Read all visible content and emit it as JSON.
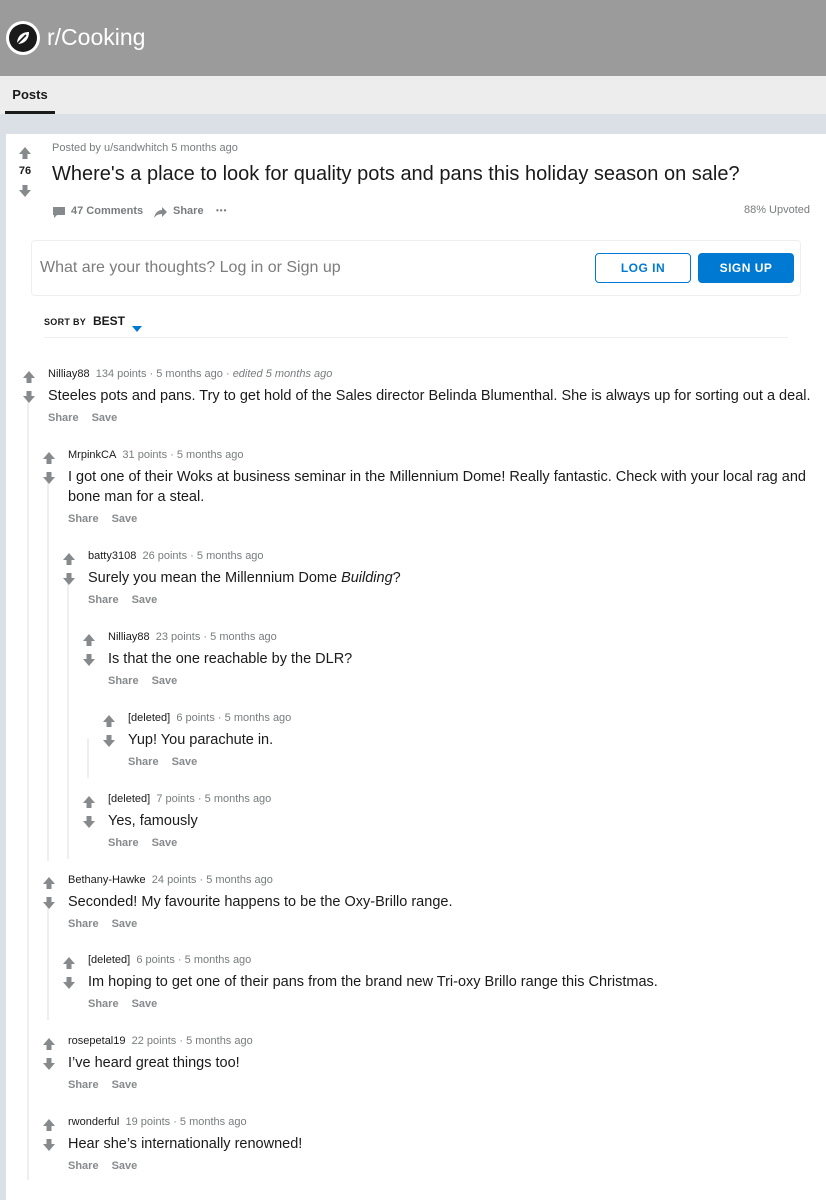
{
  "header": {
    "subreddit": "r/Cooking",
    "icon": "subreddit-leaf-icon"
  },
  "tabs": [
    {
      "label": "Posts",
      "active": true
    }
  ],
  "post": {
    "score": "76",
    "meta": "Posted by u/sandwhitch 5 months ago",
    "title": "Where's a place to look for quality pots and pans this holiday season on sale?",
    "comments_label": "47 Comments",
    "share_label": "Share",
    "more_label": "•••",
    "upvoted": "88% Upvoted"
  },
  "comment_box": {
    "placeholder": "What are your thoughts? Log in or Sign up",
    "login_label": "LOG IN",
    "signup_label": "SIGN UP"
  },
  "sort": {
    "label": "SORT BY",
    "value": "BEST"
  },
  "colors": {
    "accent": "#0079d3",
    "header_bg": "#9b9b9b",
    "page_bg": "#dae0e6",
    "arrow": "#878a8c"
  },
  "comments": [
    {
      "author": "Nilliay88",
      "points": "134 points",
      "time": "5 months ago",
      "edited": "edited 5 months ago",
      "body": "Steeles pots and pans. Try to get hold of the Sales director Belinda Blumenthal. She is always up for sorting out a deal.",
      "share": "Share",
      "save": "Save"
    },
    {
      "author": "MrpinkCA",
      "points": "31 points",
      "time": "5 months ago",
      "body_line1": "I got one of their Woks at business seminar in the Millennium Dome! Really fantastic. Check with your local rag and",
      "body_line2": "bone man for a steal.",
      "share": "Share",
      "save": "Save"
    },
    {
      "author": "batty3108",
      "points": "26 points",
      "time": "5 months ago",
      "body_pre": "Surely you mean the Millennium Dome ",
      "body_em": "Building",
      "body_post": "?",
      "share": "Share",
      "save": "Save"
    },
    {
      "author": "Nilliay88",
      "points": "23 points",
      "time": "5 months ago",
      "body": "Is that the one reachable by the DLR?",
      "share": "Share",
      "save": "Save"
    },
    {
      "author": "[deleted]",
      "points": "6 points",
      "time": "5 months ago",
      "body": "Yup! You parachute in.",
      "share": "Share",
      "save": "Save"
    },
    {
      "author": "[deleted]",
      "points": "7 points",
      "time": "5 months ago",
      "body": "Yes, famously",
      "share": "Share",
      "save": "Save"
    },
    {
      "author": "Bethany-Hawke",
      "points": "24 points",
      "time": "5 months ago",
      "body": "Seconded! My favourite happens to be the Oxy-Brillo range.",
      "share": "Share",
      "save": "Save"
    },
    {
      "author": "[deleted]",
      "points": "6 points",
      "time": "5 months ago",
      "body": "Im hoping to get one of their pans from the brand new Tri-oxy Brillo range this Christmas.",
      "share": "Share",
      "save": "Save"
    },
    {
      "author": "rosepetal19",
      "points": "22 points",
      "time": "5 months ago",
      "body": "I’ve heard great things too!",
      "share": "Share",
      "save": "Save"
    },
    {
      "author": "rwonderful",
      "points": "19 points",
      "time": "5 months ago",
      "body": "Hear she’s internationally renowned!",
      "share": "Share",
      "save": "Save"
    }
  ]
}
